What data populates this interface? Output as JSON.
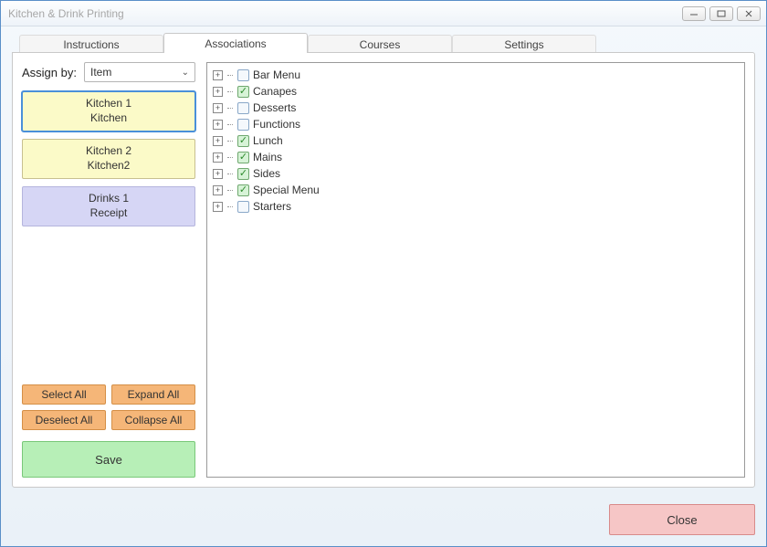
{
  "window": {
    "title": "Kitchen & Drink Printing"
  },
  "tabs": [
    {
      "label": "Instructions",
      "active": false
    },
    {
      "label": "Associations",
      "active": true
    },
    {
      "label": "Courses",
      "active": false
    },
    {
      "label": "Settings",
      "active": false
    }
  ],
  "assign": {
    "label": "Assign by:",
    "value": "Item"
  },
  "printers": [
    {
      "line1": "Kitchen 1",
      "line2": "Kitchen",
      "selected": true,
      "variant": "kitchen"
    },
    {
      "line1": "Kitchen 2",
      "line2": "Kitchen2",
      "selected": false,
      "variant": "kitchen"
    },
    {
      "line1": "Drinks 1",
      "line2": "Receipt",
      "selected": false,
      "variant": "drinks"
    }
  ],
  "action_buttons": {
    "select_all": "Select All",
    "expand_all": "Expand All",
    "deselect_all": "Deselect All",
    "collapse_all": "Collapse All",
    "save": "Save"
  },
  "tree_items": [
    {
      "label": "Bar Menu",
      "checked": false
    },
    {
      "label": "Canapes",
      "checked": true
    },
    {
      "label": "Desserts",
      "checked": false
    },
    {
      "label": "Functions",
      "checked": false
    },
    {
      "label": "Lunch",
      "checked": true
    },
    {
      "label": "Mains",
      "checked": true
    },
    {
      "label": "Sides",
      "checked": true
    },
    {
      "label": "Special Menu",
      "checked": true
    },
    {
      "label": "Starters",
      "checked": false
    }
  ],
  "footer": {
    "close": "Close"
  }
}
